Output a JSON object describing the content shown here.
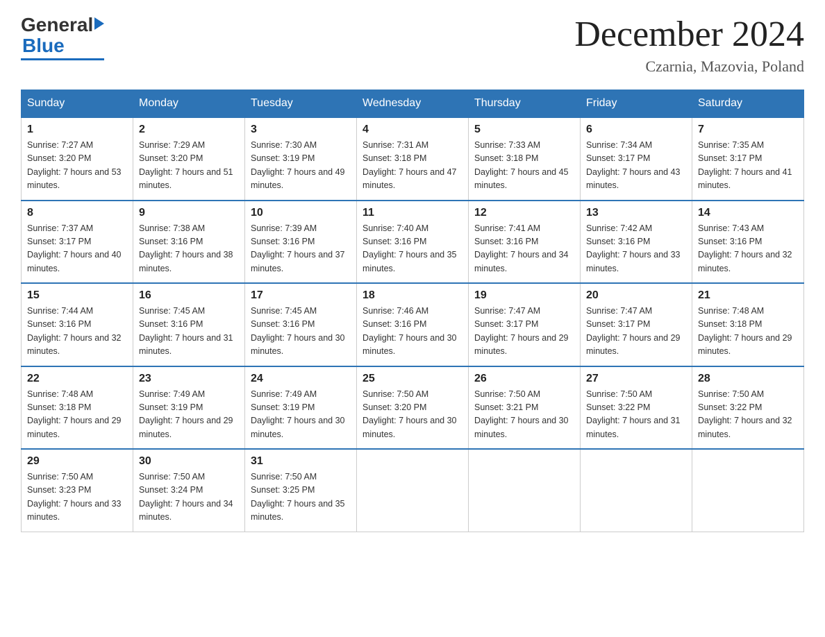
{
  "header": {
    "logo_general": "General",
    "logo_blue": "Blue",
    "month_title": "December 2024",
    "subtitle": "Czarnia, Mazovia, Poland"
  },
  "days_of_week": [
    "Sunday",
    "Monday",
    "Tuesday",
    "Wednesday",
    "Thursday",
    "Friday",
    "Saturday"
  ],
  "weeks": [
    [
      {
        "day": "1",
        "sunrise": "7:27 AM",
        "sunset": "3:20 PM",
        "daylight": "7 hours and 53 minutes."
      },
      {
        "day": "2",
        "sunrise": "7:29 AM",
        "sunset": "3:20 PM",
        "daylight": "7 hours and 51 minutes."
      },
      {
        "day": "3",
        "sunrise": "7:30 AM",
        "sunset": "3:19 PM",
        "daylight": "7 hours and 49 minutes."
      },
      {
        "day": "4",
        "sunrise": "7:31 AM",
        "sunset": "3:18 PM",
        "daylight": "7 hours and 47 minutes."
      },
      {
        "day": "5",
        "sunrise": "7:33 AM",
        "sunset": "3:18 PM",
        "daylight": "7 hours and 45 minutes."
      },
      {
        "day": "6",
        "sunrise": "7:34 AM",
        "sunset": "3:17 PM",
        "daylight": "7 hours and 43 minutes."
      },
      {
        "day": "7",
        "sunrise": "7:35 AM",
        "sunset": "3:17 PM",
        "daylight": "7 hours and 41 minutes."
      }
    ],
    [
      {
        "day": "8",
        "sunrise": "7:37 AM",
        "sunset": "3:17 PM",
        "daylight": "7 hours and 40 minutes."
      },
      {
        "day": "9",
        "sunrise": "7:38 AM",
        "sunset": "3:16 PM",
        "daylight": "7 hours and 38 minutes."
      },
      {
        "day": "10",
        "sunrise": "7:39 AM",
        "sunset": "3:16 PM",
        "daylight": "7 hours and 37 minutes."
      },
      {
        "day": "11",
        "sunrise": "7:40 AM",
        "sunset": "3:16 PM",
        "daylight": "7 hours and 35 minutes."
      },
      {
        "day": "12",
        "sunrise": "7:41 AM",
        "sunset": "3:16 PM",
        "daylight": "7 hours and 34 minutes."
      },
      {
        "day": "13",
        "sunrise": "7:42 AM",
        "sunset": "3:16 PM",
        "daylight": "7 hours and 33 minutes."
      },
      {
        "day": "14",
        "sunrise": "7:43 AM",
        "sunset": "3:16 PM",
        "daylight": "7 hours and 32 minutes."
      }
    ],
    [
      {
        "day": "15",
        "sunrise": "7:44 AM",
        "sunset": "3:16 PM",
        "daylight": "7 hours and 32 minutes."
      },
      {
        "day": "16",
        "sunrise": "7:45 AM",
        "sunset": "3:16 PM",
        "daylight": "7 hours and 31 minutes."
      },
      {
        "day": "17",
        "sunrise": "7:45 AM",
        "sunset": "3:16 PM",
        "daylight": "7 hours and 30 minutes."
      },
      {
        "day": "18",
        "sunrise": "7:46 AM",
        "sunset": "3:16 PM",
        "daylight": "7 hours and 30 minutes."
      },
      {
        "day": "19",
        "sunrise": "7:47 AM",
        "sunset": "3:17 PM",
        "daylight": "7 hours and 29 minutes."
      },
      {
        "day": "20",
        "sunrise": "7:47 AM",
        "sunset": "3:17 PM",
        "daylight": "7 hours and 29 minutes."
      },
      {
        "day": "21",
        "sunrise": "7:48 AM",
        "sunset": "3:18 PM",
        "daylight": "7 hours and 29 minutes."
      }
    ],
    [
      {
        "day": "22",
        "sunrise": "7:48 AM",
        "sunset": "3:18 PM",
        "daylight": "7 hours and 29 minutes."
      },
      {
        "day": "23",
        "sunrise": "7:49 AM",
        "sunset": "3:19 PM",
        "daylight": "7 hours and 29 minutes."
      },
      {
        "day": "24",
        "sunrise": "7:49 AM",
        "sunset": "3:19 PM",
        "daylight": "7 hours and 30 minutes."
      },
      {
        "day": "25",
        "sunrise": "7:50 AM",
        "sunset": "3:20 PM",
        "daylight": "7 hours and 30 minutes."
      },
      {
        "day": "26",
        "sunrise": "7:50 AM",
        "sunset": "3:21 PM",
        "daylight": "7 hours and 30 minutes."
      },
      {
        "day": "27",
        "sunrise": "7:50 AM",
        "sunset": "3:22 PM",
        "daylight": "7 hours and 31 minutes."
      },
      {
        "day": "28",
        "sunrise": "7:50 AM",
        "sunset": "3:22 PM",
        "daylight": "7 hours and 32 minutes."
      }
    ],
    [
      {
        "day": "29",
        "sunrise": "7:50 AM",
        "sunset": "3:23 PM",
        "daylight": "7 hours and 33 minutes."
      },
      {
        "day": "30",
        "sunrise": "7:50 AM",
        "sunset": "3:24 PM",
        "daylight": "7 hours and 34 minutes."
      },
      {
        "day": "31",
        "sunrise": "7:50 AM",
        "sunset": "3:25 PM",
        "daylight": "7 hours and 35 minutes."
      },
      null,
      null,
      null,
      null
    ]
  ]
}
